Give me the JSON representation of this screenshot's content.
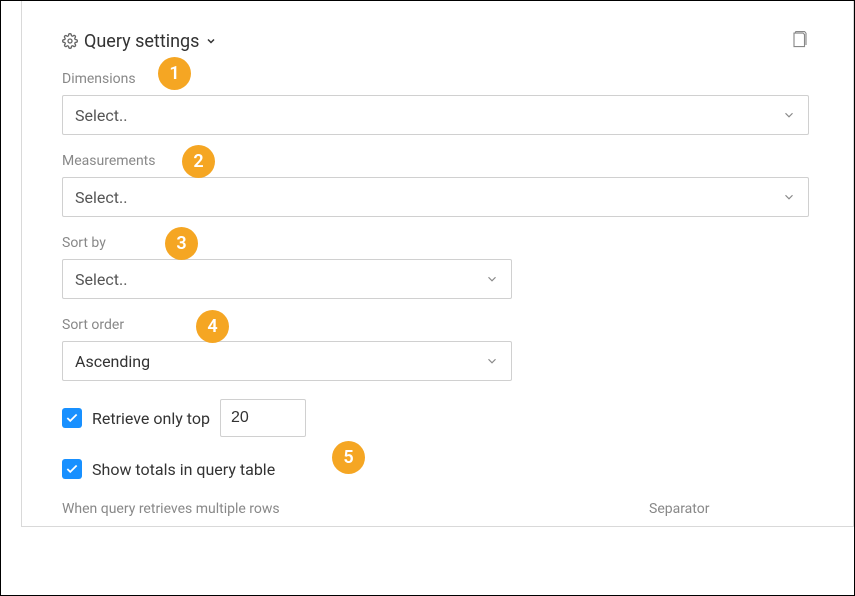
{
  "header": {
    "title": "Query settings"
  },
  "fields": {
    "dimensions": {
      "label": "Dimensions",
      "placeholder": "Select.."
    },
    "measurements": {
      "label": "Measurements",
      "placeholder": "Select.."
    },
    "sort_by": {
      "label": "Sort by",
      "placeholder": "Select.."
    },
    "sort_order": {
      "label": "Sort order",
      "value": "Ascending"
    },
    "retrieve_top": {
      "label": "Retrieve only top",
      "value": "20"
    },
    "show_totals": {
      "label": "Show totals in query table"
    },
    "multiple_rows": {
      "label": "When query retrieves multiple rows"
    },
    "separator": {
      "label": "Separator"
    }
  },
  "annotations": {
    "b1": "1",
    "b2": "2",
    "b3": "3",
    "b4": "4",
    "b5": "5"
  }
}
